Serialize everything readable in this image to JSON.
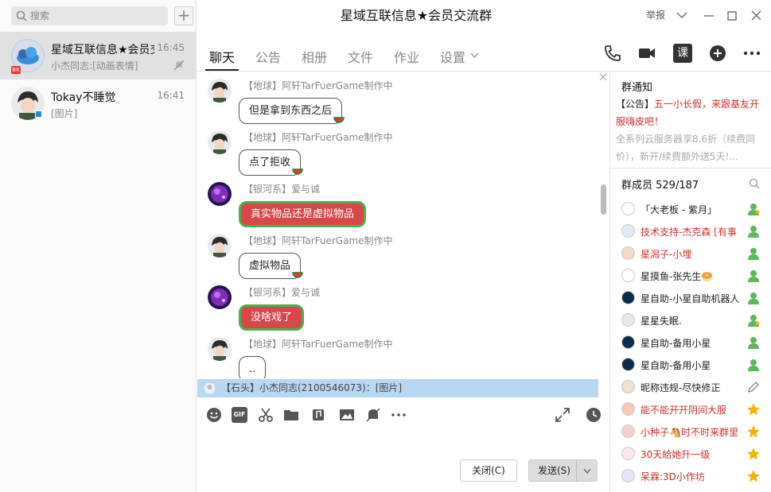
{
  "sidebar": {
    "search_placeholder": "搜索",
    "add_label": "+",
    "conversations": [
      {
        "name": "星域互联信息★会员交",
        "preview": "小杰同志:[动画表情]",
        "time": "16:45",
        "badge": "BK"
      },
      {
        "name": "Tokay不睡觉",
        "preview": "[图片]",
        "time": "16:41"
      }
    ]
  },
  "window": {
    "title": "星域互联信息★会员交流群",
    "report_label": "举报"
  },
  "tabs": [
    {
      "label": "聊天"
    },
    {
      "label": "公告"
    },
    {
      "label": "相册"
    },
    {
      "label": "文件"
    },
    {
      "label": "作业"
    },
    {
      "label": "设置"
    }
  ],
  "header_icons": {
    "class_label": "课"
  },
  "messages": [
    {
      "sender": "【地球】阿轩TarFuerGame制作中",
      "text": "但是拿到东西之后",
      "style": "normal"
    },
    {
      "sender": "【地球】阿轩TarFuerGame制作中",
      "text": "点了拒收",
      "style": "normal"
    },
    {
      "sender": "【银河系】爱与诚",
      "text": "真实物品还是虚拟物品",
      "style": "red"
    },
    {
      "sender": "【地球】阿轩TarFuerGame制作中",
      "text": "虚拟物品",
      "style": "normal"
    },
    {
      "sender": "【银河系】爱与诚",
      "text": "没啥戏了",
      "style": "red"
    },
    {
      "sender": "【地球】阿轩TarFuerGame制作中",
      "text": "..",
      "style": "normal"
    }
  ],
  "new_message_notice": "【石头】小杰同志(2100546073)：[图片]",
  "composer": {
    "gif_label": "GIF",
    "close_label": "关闭(C)",
    "send_label": "发送(S)"
  },
  "group_notice": {
    "title": "群通知",
    "line1_tag": "【公告】",
    "line1": "五一小长假，来跟基友开服嗨皮吧！",
    "line2": "全系列云服务器享8.6折（续费同价），新开/续费额外送5天!..."
  },
  "members": {
    "title": "群成员 529/187",
    "list": [
      {
        "name": "「大老板 - 紫月」",
        "color": "#222222",
        "role": "owner"
      },
      {
        "name": "技术支持-杰克森 [有事",
        "color": "#d32f2f",
        "role": "admin"
      },
      {
        "name": "星潟子-小埋",
        "color": "#d32f2f",
        "role": "admin"
      },
      {
        "name": "星摸鱼-张先生🥯",
        "color": "#222222",
        "role": "admin"
      },
      {
        "name": "星自助-小星自助机器人",
        "color": "#222222",
        "role": "admin"
      },
      {
        "name": "星星失眠.",
        "color": "#222222",
        "role": "owner"
      },
      {
        "name": "星自助-备用小星",
        "color": "#222222",
        "role": "admin"
      },
      {
        "name": "星自助-备用小星",
        "color": "#222222",
        "role": "admin"
      },
      {
        "name": "昵称违规-尽快修正",
        "color": "#222222",
        "role": "edit"
      },
      {
        "name": "能不能开开阴间大服",
        "color": "#d32f2f",
        "role": "star"
      },
      {
        "name": "小种子🐴时不时来群里",
        "color": "#d32f2f",
        "role": "star"
      },
      {
        "name": "30天給她升一级",
        "color": "#d32f2f",
        "role": "star"
      },
      {
        "name": "呆霖:3D小作坊",
        "color": "#d32f2f",
        "role": "star"
      }
    ]
  },
  "colors": {
    "accent_red": "#d9474a",
    "notice_bar": "#b7d7f2",
    "member_red": "#d32f2f"
  }
}
